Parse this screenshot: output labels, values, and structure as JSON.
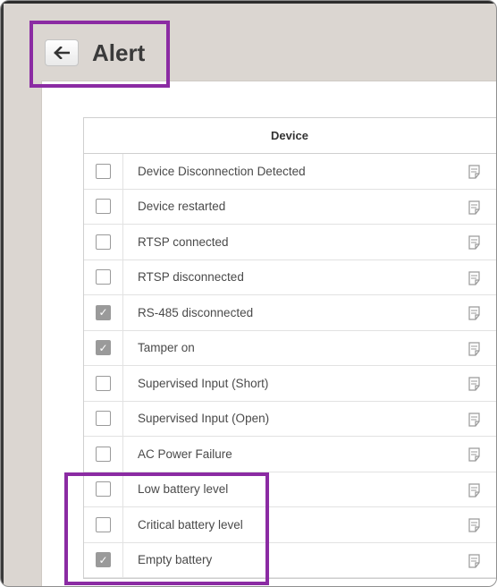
{
  "header": {
    "title": "Alert",
    "back_icon": "arrow-left-icon"
  },
  "table": {
    "column_header": "Device",
    "row_icon": "memo-icon",
    "rows": [
      {
        "label": "Device Disconnection Detected",
        "checked": false
      },
      {
        "label": "Device restarted",
        "checked": false
      },
      {
        "label": "RTSP connected",
        "checked": false
      },
      {
        "label": "RTSP disconnected",
        "checked": false
      },
      {
        "label": "RS-485 disconnected",
        "checked": true
      },
      {
        "label": "Tamper on",
        "checked": true
      },
      {
        "label": "Supervised Input (Short)",
        "checked": false
      },
      {
        "label": "Supervised Input (Open)",
        "checked": false
      },
      {
        "label": "AC Power Failure",
        "checked": false
      },
      {
        "label": "Low battery level",
        "checked": false
      },
      {
        "label": "Critical battery level",
        "checked": false
      },
      {
        "label": "Empty battery",
        "checked": true
      }
    ]
  },
  "colors": {
    "highlight": "#8b2ba3",
    "checkbox_checked": "#9a9a9a",
    "background": "#dbd6d1"
  }
}
